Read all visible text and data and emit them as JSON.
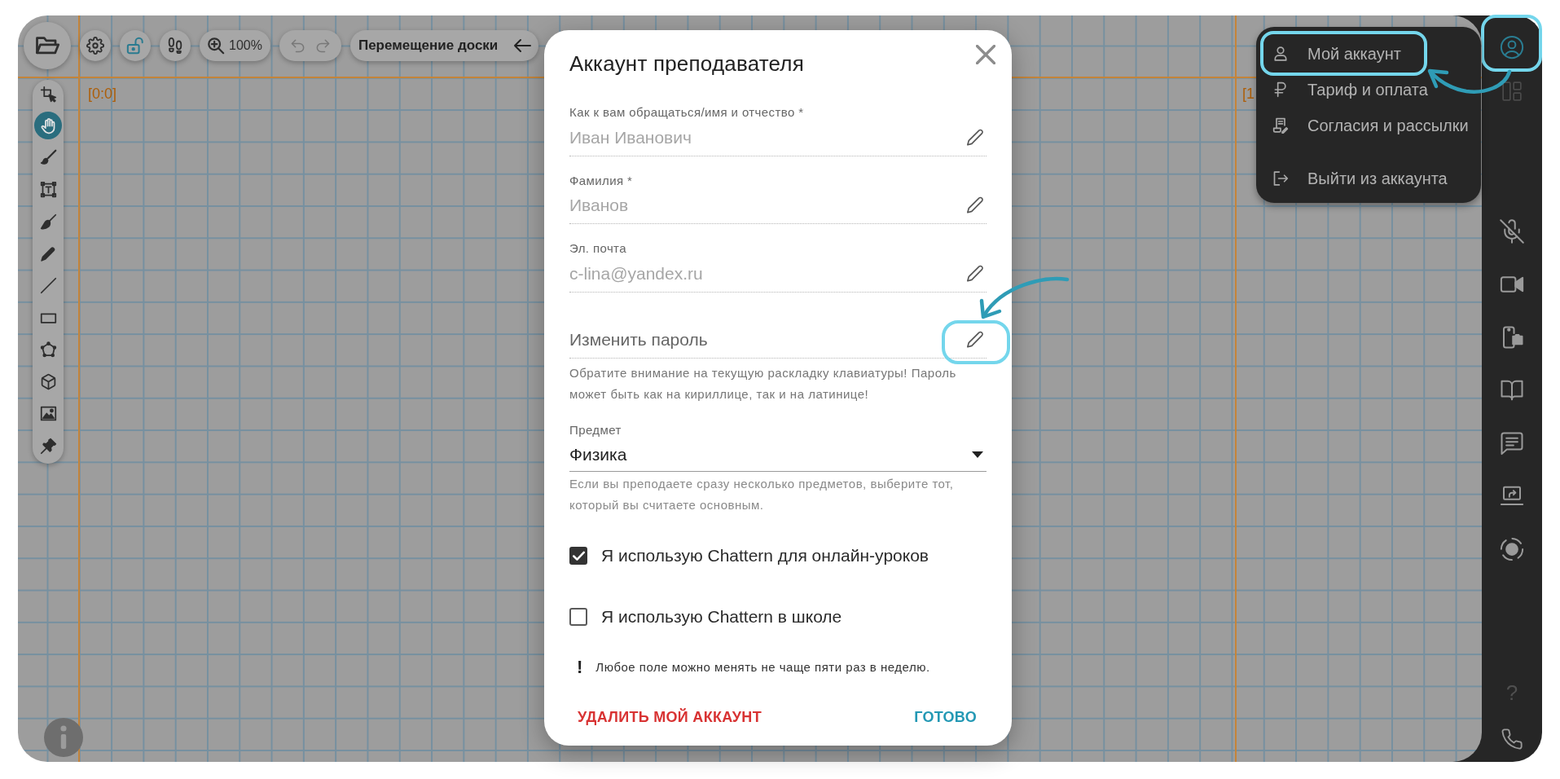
{
  "top_toolbar": {
    "zoom_level": "100%",
    "undo": {
      "disabled": true
    },
    "redo": {
      "disabled": true
    },
    "mode_label": "Перемещение доски"
  },
  "left_toolbar": {
    "tools": [
      {
        "kind": "select",
        "selected": false
      },
      {
        "kind": "hand",
        "selected": true
      },
      {
        "kind": "brush",
        "selected": false
      },
      {
        "kind": "text",
        "selected": false
      },
      {
        "kind": "broom",
        "selected": false
      },
      {
        "kind": "pencil",
        "selected": false
      },
      {
        "kind": "line",
        "selected": false
      },
      {
        "kind": "rectangle",
        "selected": false
      },
      {
        "kind": "polygon",
        "selected": false
      },
      {
        "kind": "cube",
        "selected": false
      },
      {
        "kind": "image",
        "selected": false
      },
      {
        "kind": "pin",
        "selected": false
      }
    ]
  },
  "board": {
    "origin_label": "[0:0]",
    "edge_label": "[1"
  },
  "dialog": {
    "title": "Аккаунт преподавателя",
    "fields": [
      {
        "kind": "text",
        "label": "Как к вам обращаться/имя и отчество *",
        "value": "Иван Иванович",
        "readonly": true,
        "highlighted": false
      },
      {
        "kind": "text",
        "label": "Фамилия *",
        "value": "Иванов",
        "readonly": true,
        "highlighted": false
      },
      {
        "kind": "text",
        "label": "Эл. почта",
        "value": "c-lina@yandex.ru",
        "readonly": true,
        "highlighted": false
      },
      {
        "kind": "password",
        "placeholder": "Изменить пароль",
        "hint": "Обратите внимание на текущую раскладку клавиатуры! Пароль может быть как на кириллице, так и на латинице!",
        "highlighted": true
      }
    ],
    "subject": {
      "label": "Предмет",
      "value": "Физика",
      "hint": "Если вы преподаете сразу несколько предметов, выберите тот, который вы считаете основным."
    },
    "checkboxes": [
      {
        "label": "Я использую Chattern для онлайн-уроков",
        "checked": true
      },
      {
        "label": "Я использую Chattern в школе",
        "checked": false
      }
    ],
    "note": {
      "mark": "!",
      "text": "Любое поле можно менять не чаще пяти раз в неделю."
    },
    "buttons": [
      {
        "kind": "danger",
        "label": "УДАЛИТЬ МОЙ АККАУНТ"
      },
      {
        "kind": "primary",
        "label": "ГОТОВО"
      }
    ]
  },
  "account_menu": {
    "groups": [
      {
        "items": [
          {
            "kind": "user",
            "label": "Мой аккаунт",
            "highlighted": true
          },
          {
            "kind": "ruble",
            "label": "Тариф и оплата",
            "highlighted": false
          },
          {
            "kind": "consents",
            "label": "Согласия и рассылки",
            "highlighted": false
          }
        ]
      },
      {
        "items": [
          {
            "kind": "logout",
            "label": "Выйти из аккаунта",
            "highlighted": false
          }
        ]
      }
    ]
  },
  "sidebar": {
    "account_button": {
      "highlighted": true
    },
    "microphone": {
      "muted": true
    },
    "help_label": "?"
  }
}
